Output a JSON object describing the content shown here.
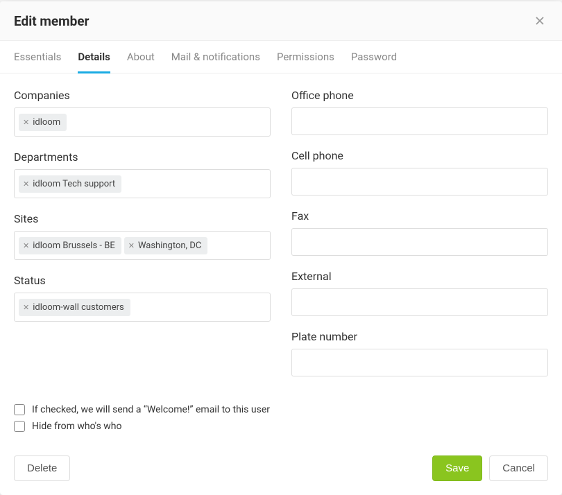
{
  "modal": {
    "title": "Edit member"
  },
  "tabs": [
    {
      "label": "Essentials",
      "active": false
    },
    {
      "label": "Details",
      "active": true
    },
    {
      "label": "About",
      "active": false
    },
    {
      "label": "Mail & notifications",
      "active": false
    },
    {
      "label": "Permissions",
      "active": false
    },
    {
      "label": "Password",
      "active": false
    }
  ],
  "left_fields": {
    "companies": {
      "label": "Companies",
      "tags": [
        "idloom"
      ]
    },
    "departments": {
      "label": "Departments",
      "tags": [
        "idloom Tech support"
      ]
    },
    "sites": {
      "label": "Sites",
      "tags": [
        "idloom Brussels - BE",
        "Washington, DC"
      ]
    },
    "status": {
      "label": "Status",
      "tags": [
        "idloom-wall customers"
      ]
    }
  },
  "right_fields": {
    "office_phone": {
      "label": "Office phone",
      "value": ""
    },
    "cell_phone": {
      "label": "Cell phone",
      "value": ""
    },
    "fax": {
      "label": "Fax",
      "value": ""
    },
    "external": {
      "label": "External",
      "value": ""
    },
    "plate_number": {
      "label": "Plate number",
      "value": ""
    }
  },
  "checks": {
    "welcome": {
      "label": "If checked, we will send a “Welcome!” email to this user",
      "checked": false
    },
    "hide": {
      "label": "Hide from who's who",
      "checked": false
    }
  },
  "buttons": {
    "delete": "Delete",
    "save": "Save",
    "cancel": "Cancel"
  }
}
